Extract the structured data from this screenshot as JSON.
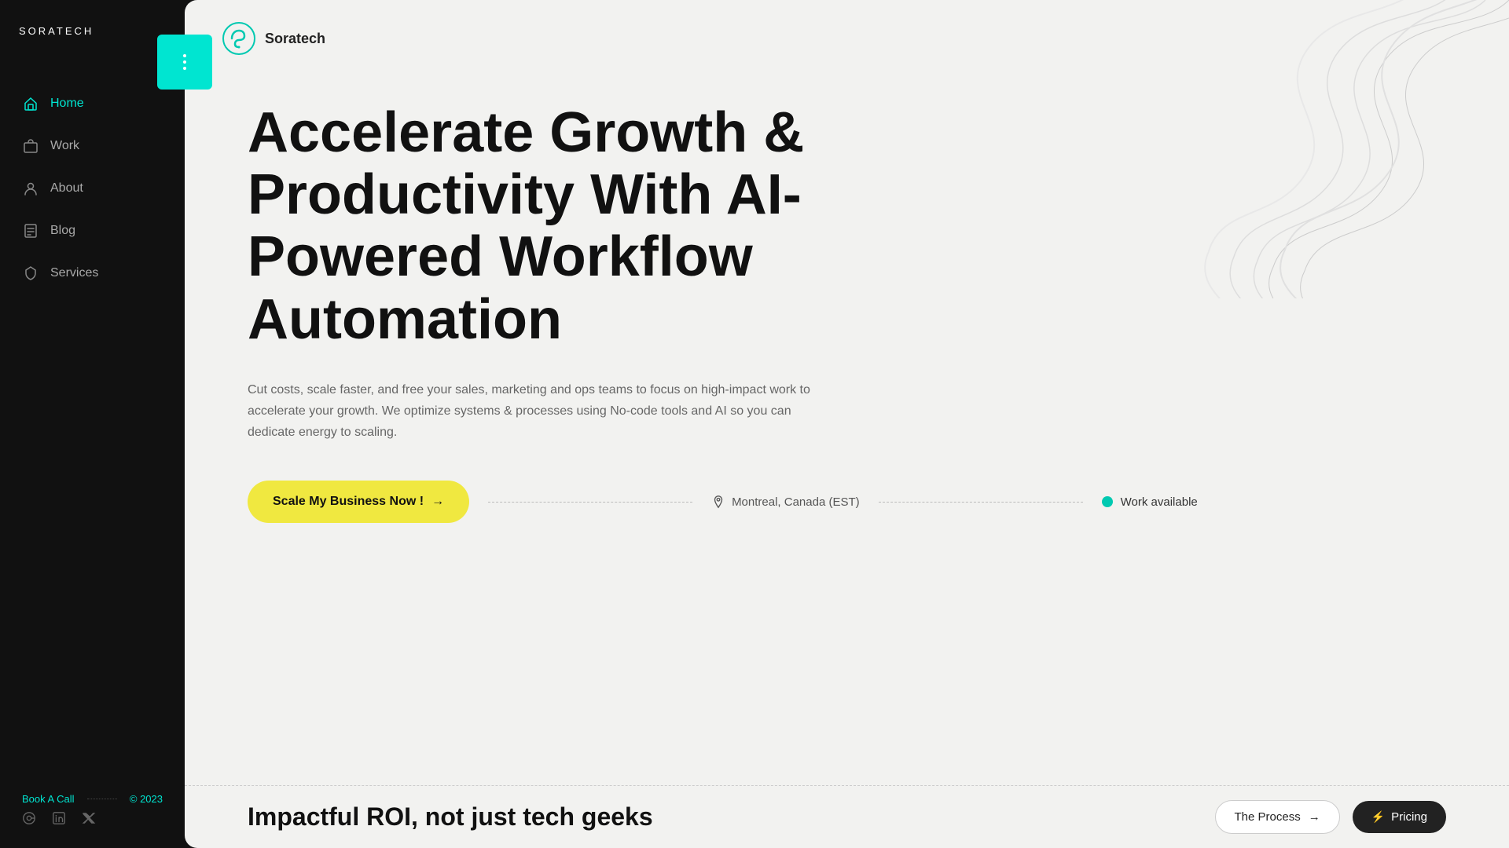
{
  "sidebar": {
    "brand": "SORATECH",
    "nav": [
      {
        "id": "home",
        "label": "Home",
        "active": true
      },
      {
        "id": "work",
        "label": "Work",
        "active": false
      },
      {
        "id": "about",
        "label": "About",
        "active": false
      },
      {
        "id": "blog",
        "label": "Blog",
        "active": false
      },
      {
        "id": "services",
        "label": "Services",
        "active": false
      }
    ],
    "book_call": "Book A Call",
    "copyright": "© 2023",
    "social": [
      "email-icon",
      "linkedin-icon",
      "twitter-icon"
    ]
  },
  "topnav": {
    "brand": "Soratech"
  },
  "hero": {
    "title": "Accelerate Growth & Productivity With AI-Powered Workflow Automation",
    "subtitle": "Cut costs, scale faster, and free your sales, marketing and ops teams to focus on high-impact work to accelerate your growth. We optimize systems & processes using No-code tools and AI so you can dedicate energy to scaling.",
    "cta_label": "Scale My Business Now !",
    "location": "Montreal, Canada (EST)",
    "availability": "Work available"
  },
  "bottom": {
    "tagline": "Impactful ROI, not just tech geeks",
    "process_label": "The Process",
    "pricing_label": "Pricing"
  },
  "colors": {
    "cyan": "#00e5d1",
    "yellow": "#f0e840",
    "dark": "#111111",
    "light_bg": "#f2f2f0"
  }
}
